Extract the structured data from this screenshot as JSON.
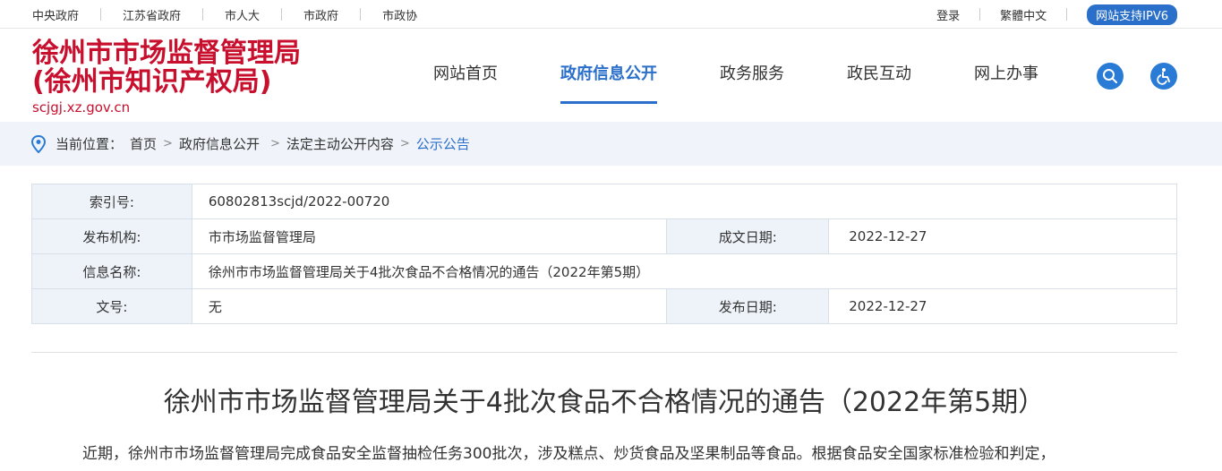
{
  "topbar": {
    "links": [
      "中央政府",
      "江苏省政府",
      "市人大",
      "市政府",
      "市政协"
    ],
    "login": "登录",
    "lang": "繁體中文",
    "ipv6": "网站支持IPV6"
  },
  "header": {
    "title_line1": "徐州市市场监督管理局",
    "title_line2": "(徐州市知识产权局)",
    "url": "scjgj.xz.gov.cn",
    "nav": [
      "网站首页",
      "政府信息公开",
      "政务服务",
      "政民互动",
      "网上办事"
    ],
    "active_nav": "政府信息公开"
  },
  "breadcrumb": {
    "label": "当前位置：",
    "items": [
      "首页",
      "政府信息公开",
      "法定主动公开内容",
      "公示公告"
    ]
  },
  "info": {
    "index_label": "索引号:",
    "index_value": "60802813scjd/2022-00720",
    "org_label": "发布机构:",
    "org_value": "市市场监督管理局",
    "created_label": "成文日期:",
    "created_value": "2022-12-27",
    "name_label": "信息名称:",
    "name_value": "徐州市市场监督管理局关于4批次食品不合格情况的通告（2022年第5期）",
    "docno_label": "文号:",
    "docno_value": "无",
    "published_label": "发布日期:",
    "published_value": "2022-12-27"
  },
  "article": {
    "title": "徐州市市场监督管理局关于4批次食品不合格情况的通告（2022年第5期）",
    "body": "近期，徐州市市场监督管理局完成食品安全监督抽检任务300批次，涉及糕点、炒货食品及坚果制品等食品。根据食品安全国家标准检验和判定，"
  },
  "icons": {
    "location": "location-pin-icon",
    "search": "search-icon",
    "accessibility": "accessibility-icon"
  },
  "colors": {
    "brand_red": "#c8102e",
    "accent_blue": "#2a6fc9"
  }
}
